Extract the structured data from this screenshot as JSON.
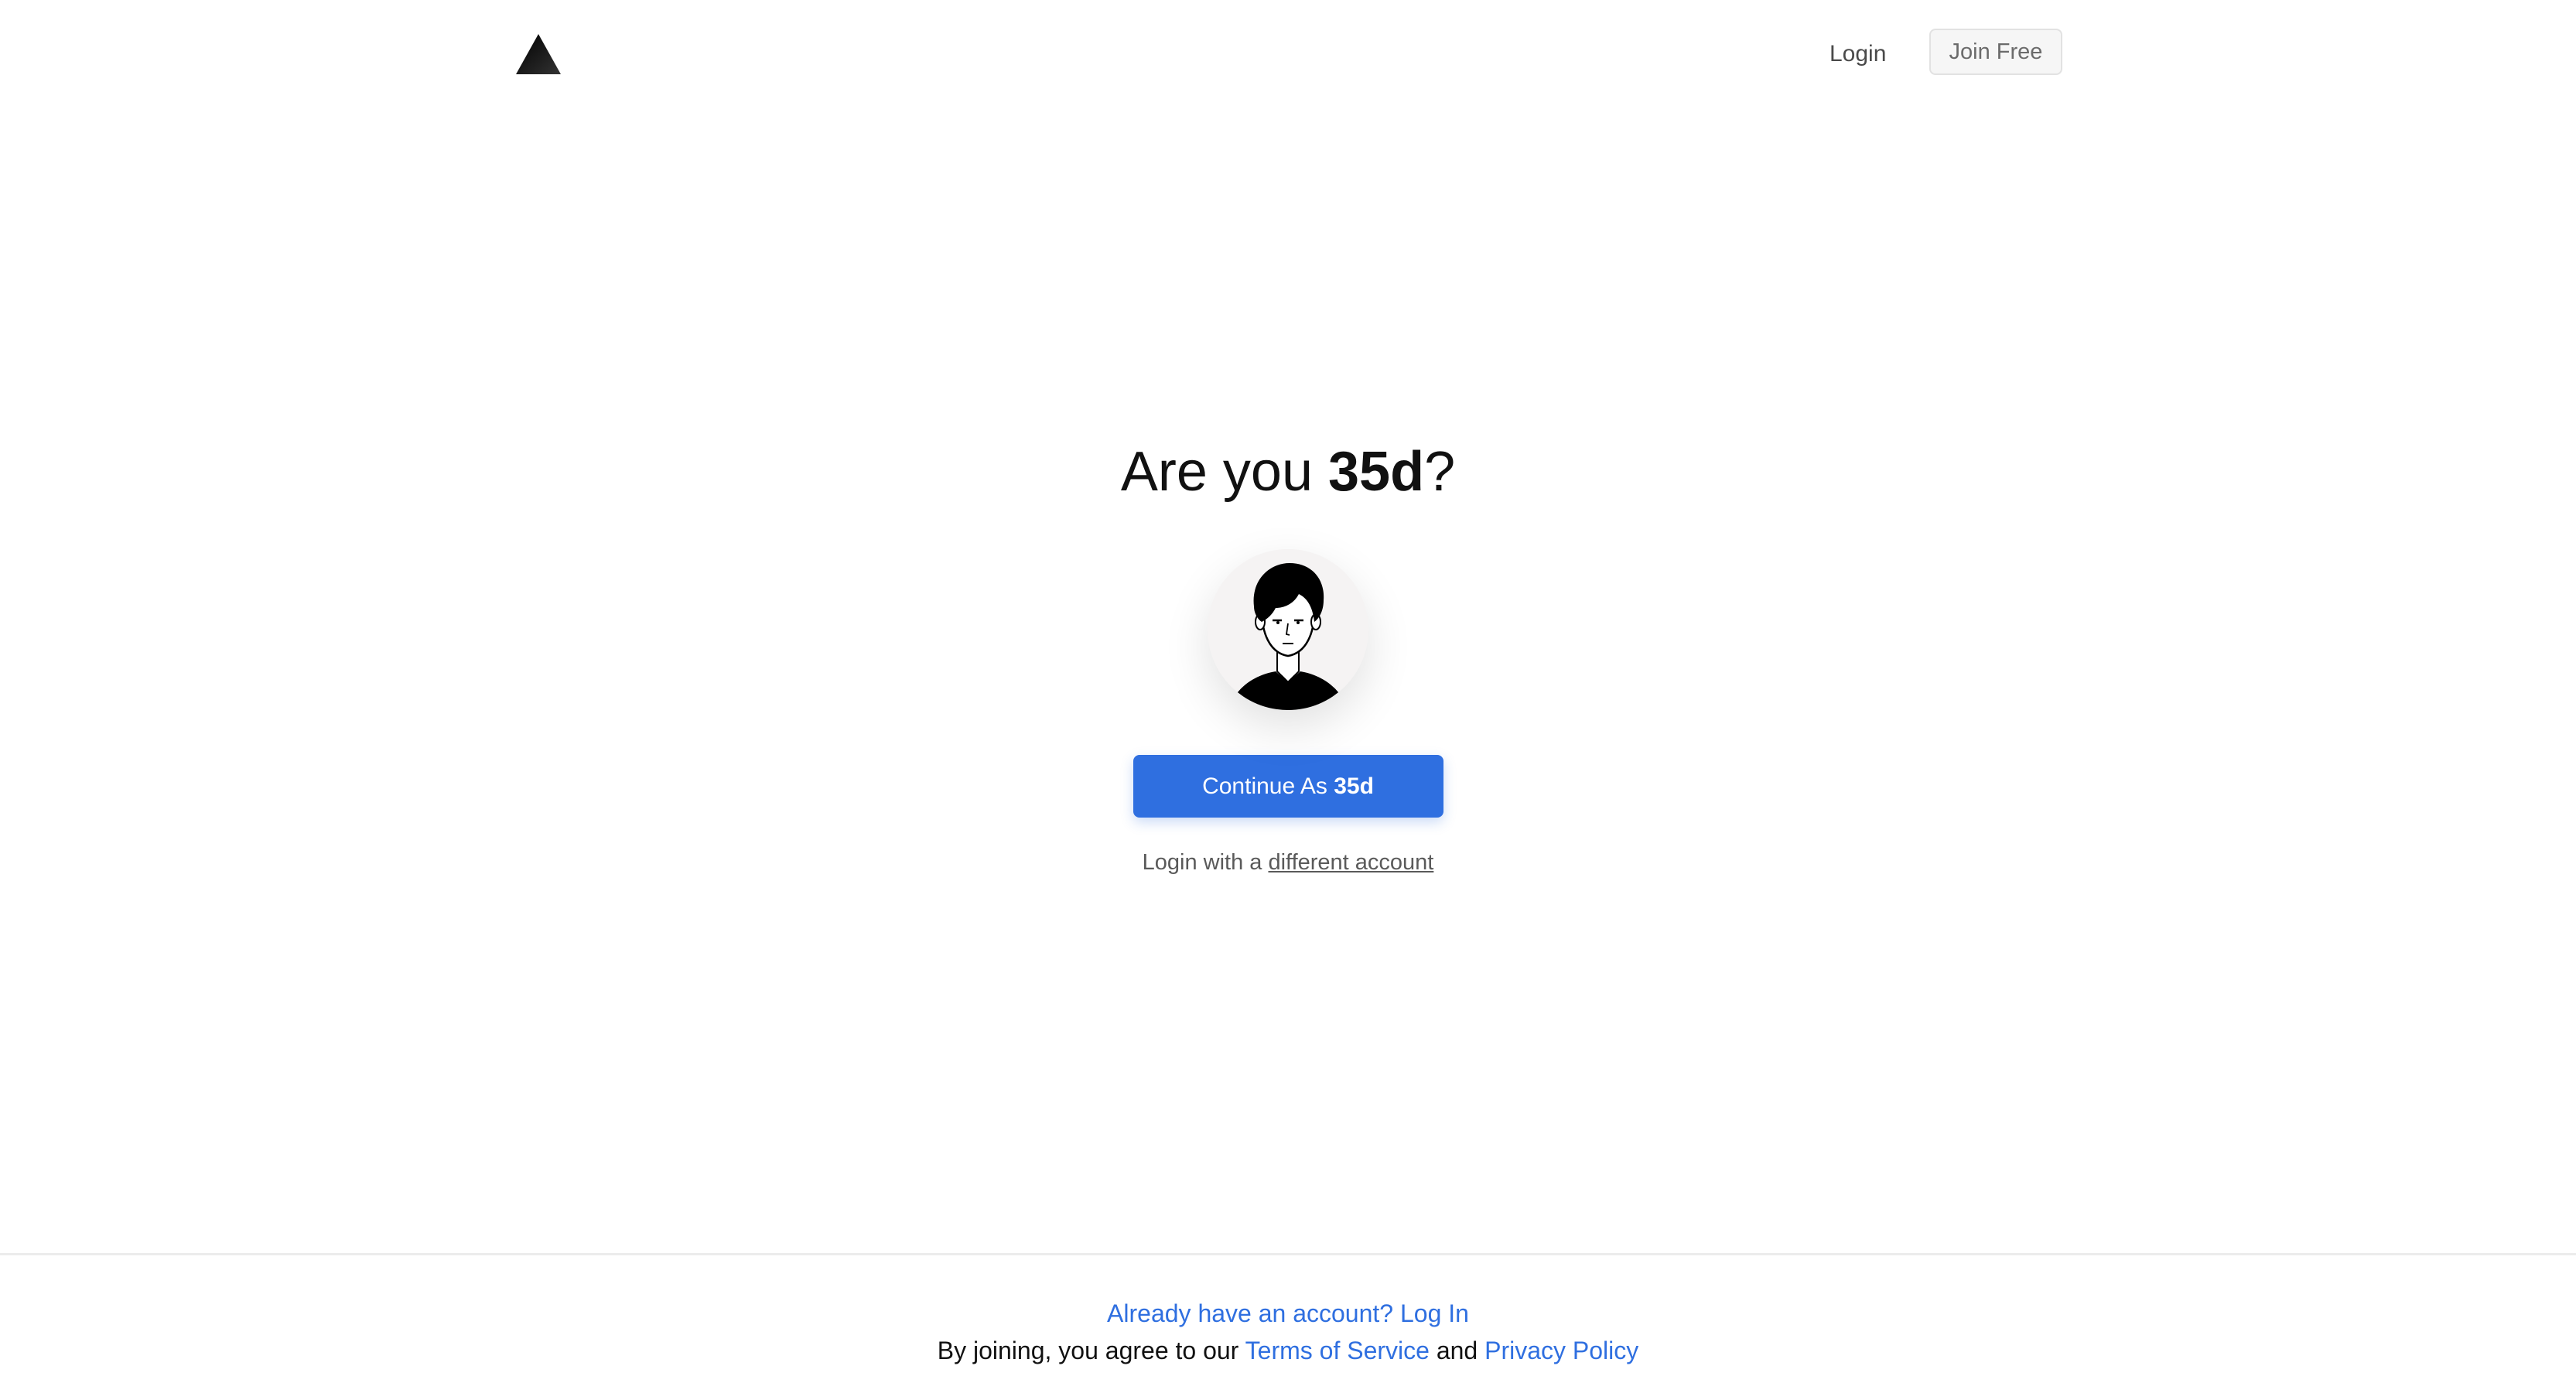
{
  "header": {
    "logo_icon": "triangle-logo-icon",
    "login_label": "Login",
    "join_label": "Join Free"
  },
  "main": {
    "title_prefix": "Are you ",
    "username": "35d",
    "title_suffix": "?",
    "avatar_icon": "user-avatar-illustration",
    "continue_prefix": "Continue As ",
    "continue_name": "35d",
    "alt_login_text": "Login with a ",
    "alt_login_link": "different account"
  },
  "footer": {
    "login_prompt": "Already have an account? Log In",
    "terms_prefix": "By joining, you agree to our ",
    "terms_link": "Terms of Service",
    "terms_and": " and ",
    "privacy_link": "Privacy Policy"
  },
  "colors": {
    "accent": "#2f6fe0",
    "text": "#111111",
    "muted": "#5a5a5a"
  }
}
